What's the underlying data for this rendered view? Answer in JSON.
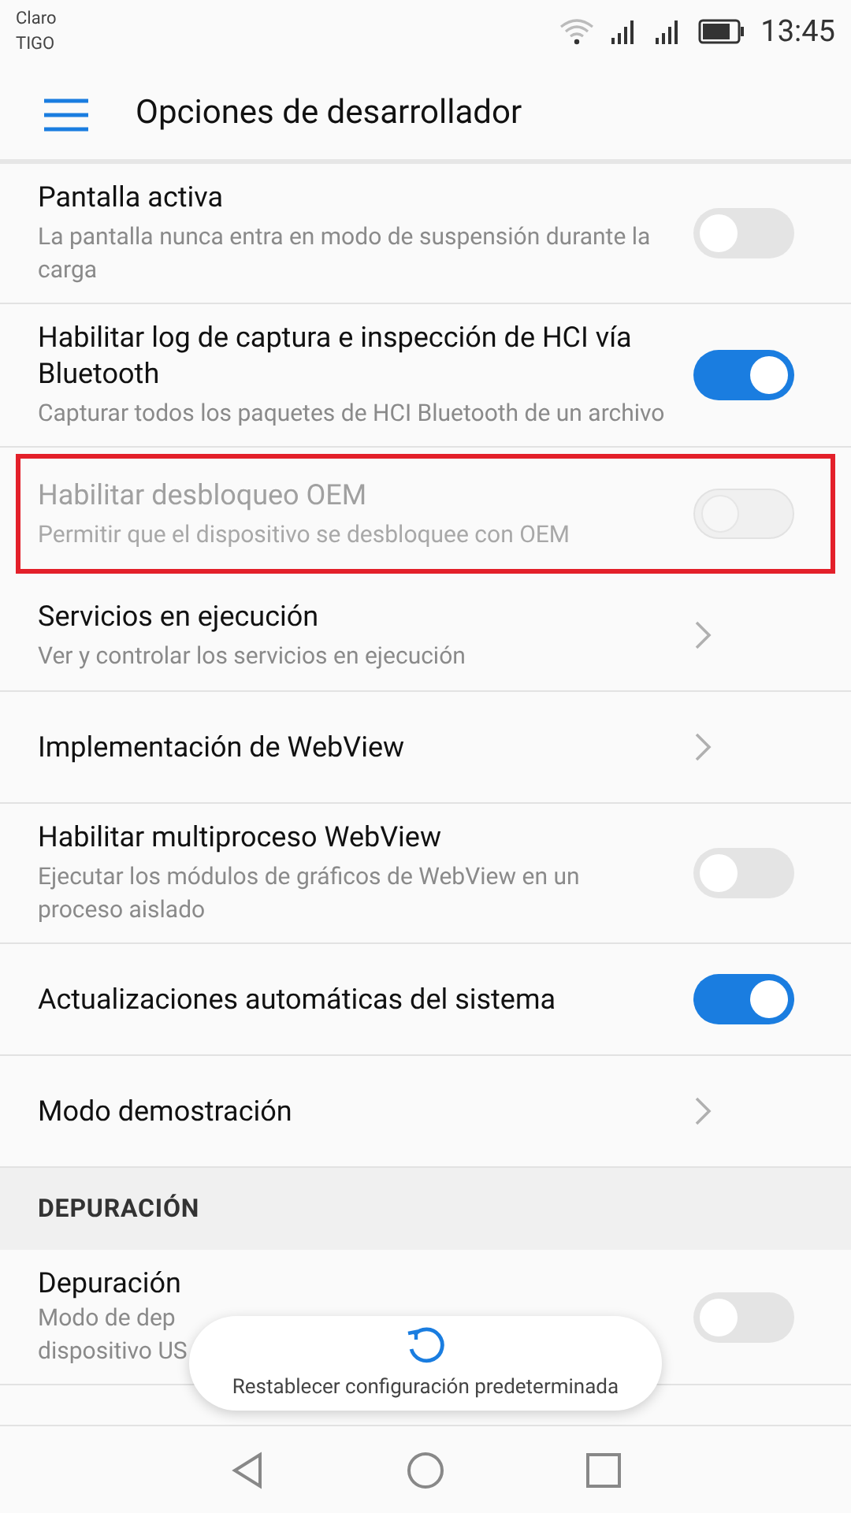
{
  "status_bar": {
    "carriers": [
      "Claro",
      "TIGO"
    ],
    "time": "13:45"
  },
  "header": {
    "title": "Opciones de desarrollador"
  },
  "items": [
    {
      "kind": "toggle",
      "title": "Pantalla activa",
      "subtitle": "La pantalla nunca entra en modo de suspensión durante la carga",
      "on": false,
      "disabled": false,
      "highlighted": false
    },
    {
      "kind": "toggle",
      "title": "Habilitar log de captura e inspección de HCI vía Bluetooth",
      "subtitle": "Capturar todos los paquetes de HCI Bluetooth de un archivo",
      "on": true,
      "disabled": false,
      "highlighted": false
    },
    {
      "kind": "toggle",
      "title": "Habilitar desbloqueo OEM",
      "subtitle": "Permitir que el dispositivo se desbloquee con OEM",
      "on": false,
      "disabled": true,
      "highlighted": true
    },
    {
      "kind": "link",
      "title": "Servicios en ejecución",
      "subtitle": "Ver y controlar los servicios en ejecución",
      "disabled": false,
      "highlighted": false
    },
    {
      "kind": "link",
      "title": "Implementación de WebView",
      "disabled": false,
      "highlighted": false
    },
    {
      "kind": "toggle",
      "title": "Habilitar multiproceso WebView",
      "subtitle": "Ejecutar los módulos de gráficos de WebView en un proceso aislado",
      "on": false,
      "disabled": false,
      "highlighted": false
    },
    {
      "kind": "toggle",
      "title": "Actualizaciones automáticas del sistema",
      "on": true,
      "disabled": false,
      "highlighted": false
    },
    {
      "kind": "link",
      "title": "Modo demostración",
      "disabled": false,
      "highlighted": false
    },
    {
      "kind": "section",
      "title": "DEPURACIÓN"
    },
    {
      "kind": "toggle",
      "title": "Depuración",
      "subtitle_lines": [
        "Modo de dep",
        "dispositivo US"
      ],
      "on": false,
      "disabled": false,
      "highlighted": false
    }
  ],
  "toast": {
    "text": "Restablecer configuración predeterminada"
  }
}
